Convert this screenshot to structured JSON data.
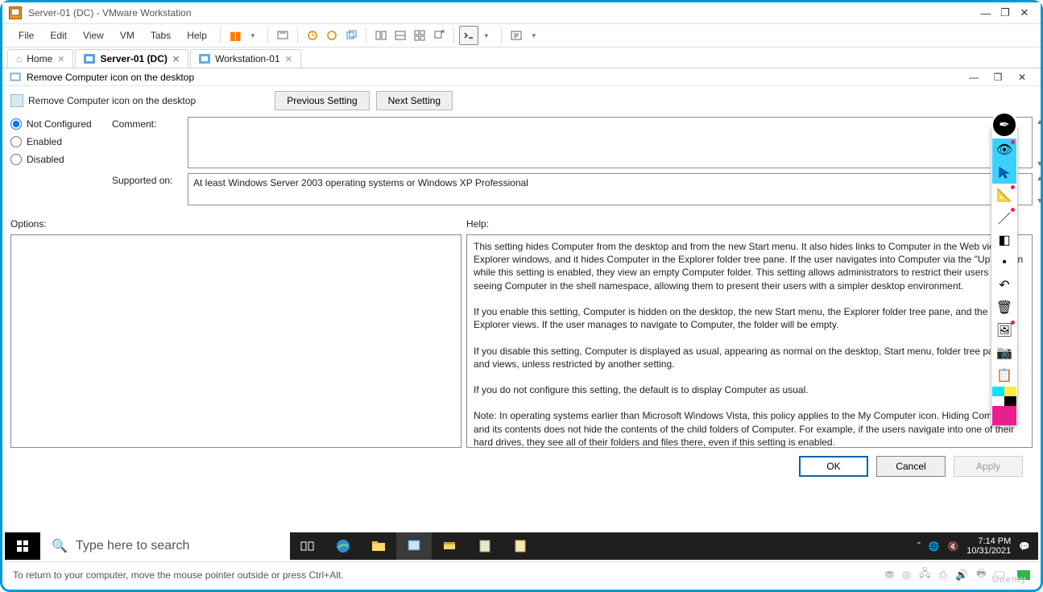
{
  "vmware": {
    "title": "Server-01 (DC) - VMware Workstation",
    "menu": [
      "File",
      "Edit",
      "View",
      "VM",
      "Tabs",
      "Help"
    ]
  },
  "tabs": {
    "home": "Home",
    "active": "Server-01 (DC)",
    "second": "Workstation-01"
  },
  "dialog": {
    "window_title": "Remove Computer icon on the desktop",
    "header_label": "Remove Computer icon on the desktop",
    "prev_btn": "Previous Setting",
    "next_btn": "Next Setting",
    "radio_not_configured": "Not Configured",
    "radio_enabled": "Enabled",
    "radio_disabled": "Disabled",
    "comment_label": "Comment:",
    "comment_value": "",
    "supported_label": "Supported on:",
    "supported_value": "At least Windows Server 2003 operating systems or Windows XP Professional",
    "options_label": "Options:",
    "help_label": "Help:",
    "help_p1": "This setting hides Computer from the desktop and from the new Start menu. It also hides links to Computer in the Web view of Explorer windows, and it hides Computer in the Explorer folder tree pane. If the user navigates into Computer via the \"Up\" button while this setting is enabled, they view an empty Computer folder. This setting allows administrators to restrict their users from seeing Computer in the shell namespace, allowing them to present their users with a simpler desktop environment.",
    "help_p2": "If you enable this setting, Computer is hidden on the desktop, the new Start menu, the Explorer folder tree pane, and the Explorer views. If the user manages to navigate to Computer, the folder will be empty.",
    "help_p3": "If you disable this setting, Computer is displayed as usual, appearing as normal on the desktop, Start menu, folder tree pane, and views, unless restricted by another setting.",
    "help_p4": "If you do not configure this setting, the default is to display Computer as usual.",
    "help_p5": "Note: In operating systems earlier than Microsoft Windows Vista, this policy applies to the My Computer icon. Hiding Computer and its contents does not hide the contents of the child folders of Computer. For example, if the users navigate into one of their hard drives, they see all of their folders and files there, even if this setting is enabled.",
    "ok": "OK",
    "cancel": "Cancel",
    "apply": "Apply"
  },
  "taskbar": {
    "search_placeholder": "Type here to search",
    "time": "7:14 PM",
    "date": "10/31/2021"
  },
  "status_bar": {
    "hint": "To return to your computer, move the mouse pointer outside or press Ctrl+Alt."
  },
  "watermark": "Udemy"
}
